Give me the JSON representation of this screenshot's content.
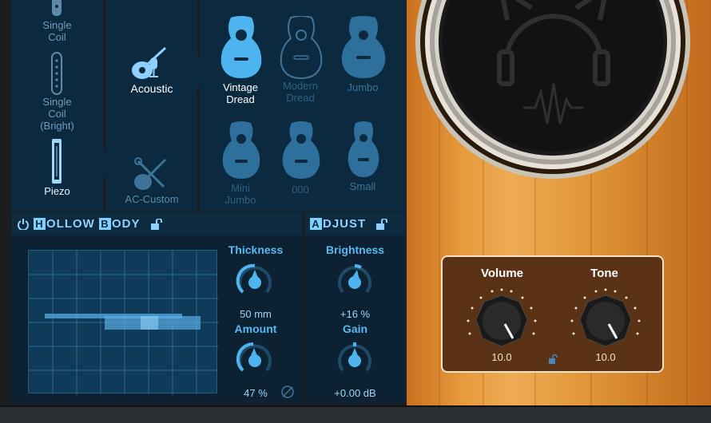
{
  "pickups": [
    {
      "label": "Single\nCoil",
      "active": false
    },
    {
      "label": "Single\nCoil\n(Bright)",
      "active": false
    },
    {
      "label": "Piezo",
      "active": true
    }
  ],
  "instrument_types": [
    {
      "label": "Acoustic",
      "active": true
    },
    {
      "label": "AC-Custom",
      "active": false
    }
  ],
  "guitar_bodies": [
    {
      "label": "Vintage\nDread",
      "active": true
    },
    {
      "label": "Modern\nDread",
      "active": false
    },
    {
      "label": "Jumbo",
      "active": false
    },
    {
      "label": "Mini\nJumbo",
      "active": false
    },
    {
      "label": "000",
      "active": false
    },
    {
      "label": "Small",
      "active": false
    }
  ],
  "hollow_body": {
    "title_rest_1": "OLLOW ",
    "title_rest_2": "ODY",
    "letter_h": "H",
    "letter_b": "B",
    "thickness_label": "Thickness",
    "thickness_value": "50 mm",
    "thickness_level": 0.5,
    "amount_label": "Amount",
    "amount_value": "47 %",
    "amount_level": 0.47
  },
  "adjust": {
    "letter_a": "A",
    "title_rest": "DJUST",
    "brightness_label": "Brightness",
    "brightness_value": "+16 %",
    "brightness_level": 0.58,
    "gain_label": "Gain",
    "gain_value": "+0.00 dB",
    "gain_level": 0.5
  },
  "output": {
    "volume_label": "Volume",
    "volume_value": "10.0",
    "tone_label": "Tone",
    "tone_value": "10.0"
  },
  "colors": {
    "accent": "#4db4f0",
    "panel": "#0b2a40",
    "wood": "#e69a3c"
  }
}
